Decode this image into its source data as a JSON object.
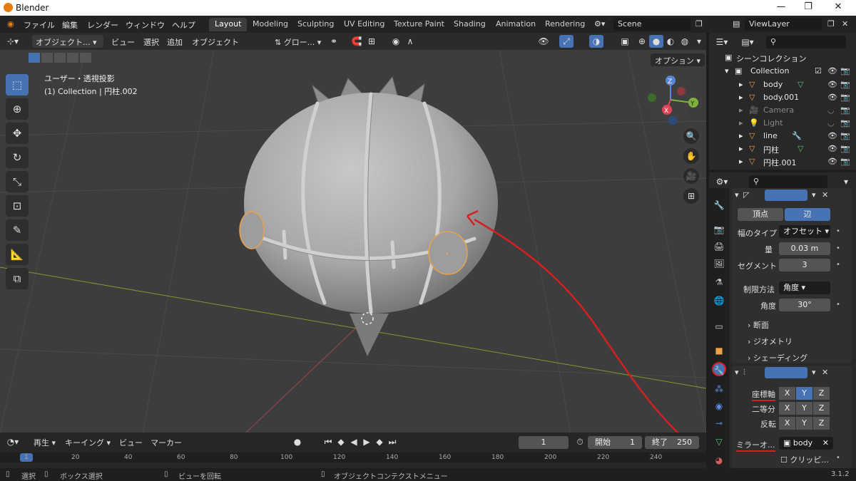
{
  "window": {
    "title": "Blender"
  },
  "menu": {
    "items": [
      "ファイル",
      "編集",
      "レンダー",
      "ウィンドウ",
      "ヘルプ"
    ],
    "workspaces": [
      "Layout",
      "Modeling",
      "Sculpting",
      "UV Editing",
      "Texture Paint",
      "Shading",
      "Animation",
      "Rendering"
    ],
    "scene": "Scene",
    "view_layer": "ViewLayer"
  },
  "viewport_header": {
    "mode": "オブジェクト...",
    "menus": [
      "ビュー",
      "選択",
      "追加",
      "オブジェクト"
    ],
    "transform_orientation": "グロー..."
  },
  "viewport": {
    "view_name": "ユーザー・透視投影",
    "collection_info": "(1) Collection | 円柱.002",
    "options_label": "オプション",
    "gizmo": {
      "x": "X",
      "y": "Y",
      "z": "Z"
    }
  },
  "outliner": {
    "scene_collection": "シーンコレクション",
    "collection": "Collection",
    "items": [
      "body",
      "body.001",
      "Camera",
      "Light",
      "line",
      "円柱",
      "円柱.001"
    ]
  },
  "properties": {
    "bevel": {
      "tabs": [
        "頂点",
        "辺"
      ],
      "width_type_label": "幅のタイプ",
      "width_type_value": "オフセット",
      "amount_label": "量",
      "amount_value": "0.03 m",
      "segments_label": "セグメント",
      "segments_value": "3",
      "limit_method_label": "制限方法",
      "limit_method_value": "角度",
      "angle_label": "角度",
      "angle_value": "30°",
      "sections": [
        "断面",
        "ジオメトリ",
        "シェーディング"
      ]
    },
    "mirror": {
      "axis_label": "座標軸",
      "bisect_label": "二等分",
      "flip_label": "反転",
      "axes": [
        "X",
        "Y",
        "Z"
      ],
      "mirror_object_label": "ミラーオ...",
      "mirror_object_value": "body",
      "clipping_label": "クリッピ..."
    }
  },
  "timeline": {
    "menus": [
      "再生",
      "キーイング",
      "ビュー",
      "マーカー"
    ],
    "current_frame": "1",
    "start_label": "開始",
    "start_value": "1",
    "end_label": "終了",
    "end_value": "250",
    "ruler_ticks": [
      "1",
      "20",
      "40",
      "60",
      "80",
      "100",
      "120",
      "140",
      "160",
      "180",
      "200",
      "220",
      "240"
    ]
  },
  "statusbar": {
    "select": "選択",
    "box_select": "ボックス選択",
    "rotate_view": "ビューを回転",
    "context_menu": "オブジェクトコンテクストメニュー",
    "version": "3.1.2"
  },
  "colors": {
    "accent": "#4772b3",
    "selection_outline": "#e8a24a",
    "annotation": "#d42020"
  }
}
